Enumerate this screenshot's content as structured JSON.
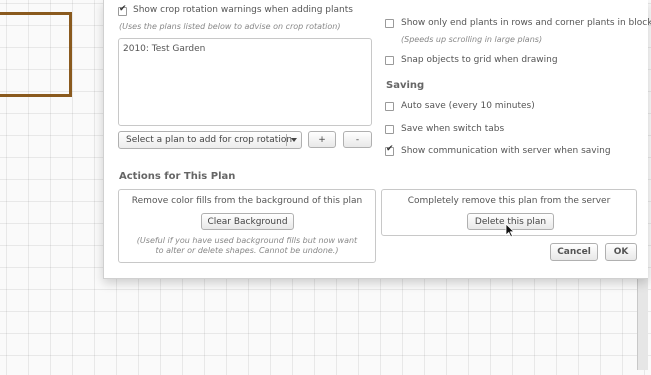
{
  "crop_rotation": {
    "show_warnings_label": "Show crop rotation warnings when adding plants",
    "show_warnings_checked": true,
    "hint": "(Uses the plans listed below to advise on crop rotation)",
    "plans": [
      "2010: Test Garden"
    ],
    "select_placeholder": "Select a plan to add for crop rotation",
    "add_label": "+",
    "remove_label": "-"
  },
  "display": {
    "end_plants_label": "Show only end plants in rows and corner plants in blocks",
    "end_plants_checked": false,
    "end_plants_hint": "(Speeds up scrolling in large plans)",
    "snap_label": "Snap objects to grid when drawing",
    "snap_checked": false
  },
  "saving": {
    "title": "Saving",
    "auto_save_label": "Auto save (every 10 minutes)",
    "auto_save_checked": false,
    "switch_tabs_label": "Save when switch tabs",
    "switch_tabs_checked": false,
    "show_comm_label": "Show communication with server when saving",
    "show_comm_checked": true
  },
  "actions": {
    "title": "Actions for This Plan",
    "clear_bg_desc": "Remove color fills from the background of this plan",
    "clear_bg_button": "Clear Background",
    "clear_bg_note_line1": "(Useful if you have used background fills but now want",
    "clear_bg_note_line2": "to alter or delete shapes. Cannot be undone.)",
    "delete_desc": "Completely remove this plan from the server",
    "delete_button": "Delete this plan"
  },
  "footer": {
    "cancel_label": "Cancel",
    "ok_label": "OK"
  },
  "colors": {
    "bed_border": "#8a5a1e",
    "grid_background": "#fafafa"
  }
}
